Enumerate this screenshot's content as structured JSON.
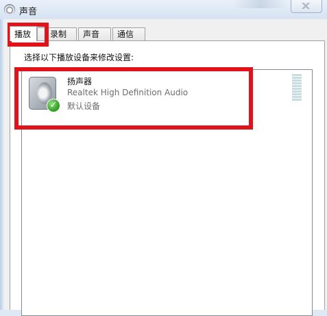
{
  "window": {
    "title": "声音"
  },
  "tabs": [
    {
      "label": "播放",
      "active": true
    },
    {
      "label": "录制",
      "active": false
    },
    {
      "label": "声音",
      "active": false
    },
    {
      "label": "通信",
      "active": false
    }
  ],
  "playback": {
    "instruction": "选择以下播放设备来修改设置:",
    "devices": [
      {
        "name": "扬声器",
        "description": "Realtek High Definition Audio",
        "status": "默认设备",
        "icon": "speaker-icon",
        "default_badge_icon": "check-icon"
      }
    ]
  },
  "annotation_color": "#e1121a"
}
